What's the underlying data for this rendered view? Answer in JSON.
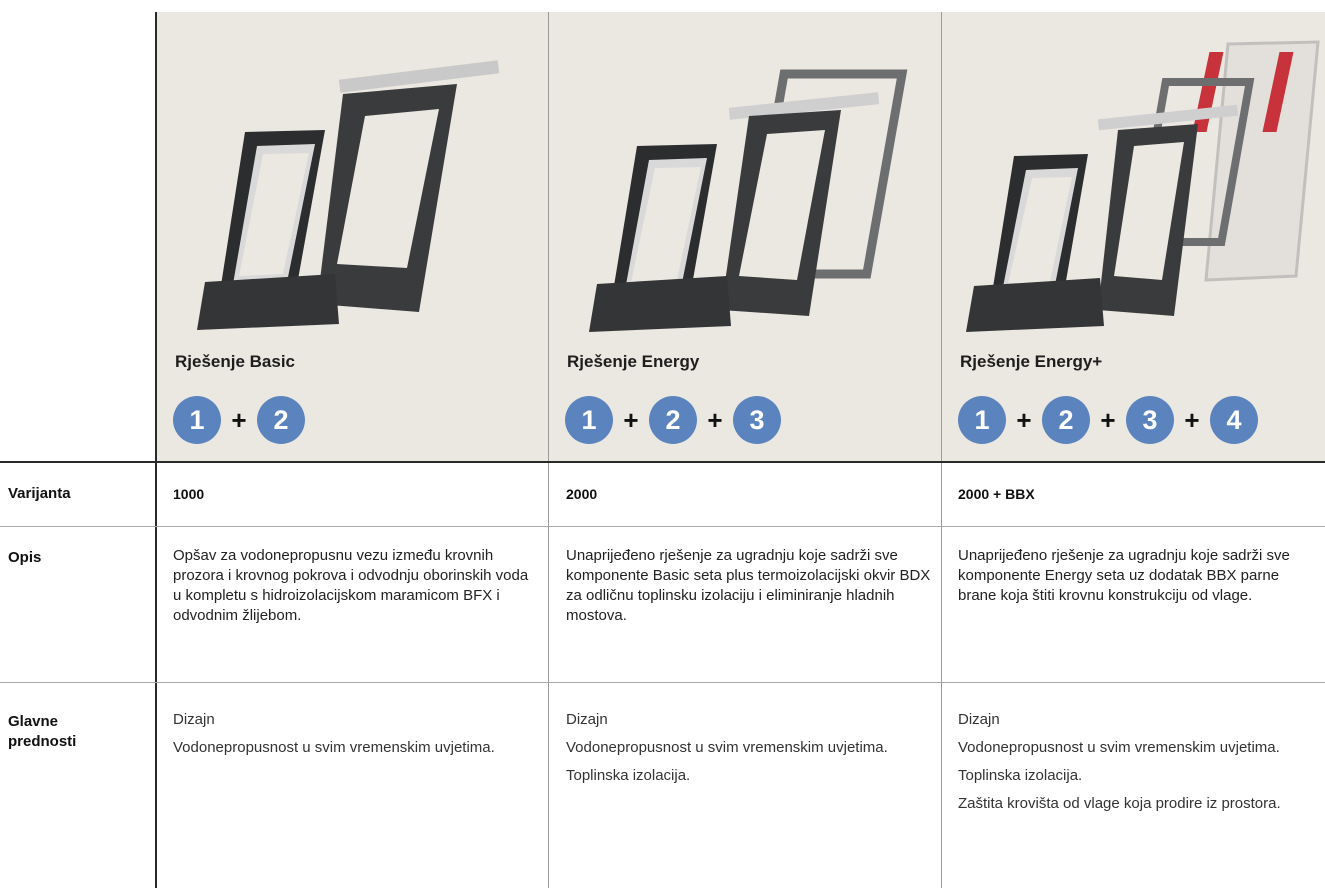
{
  "row_labels": {
    "variant": "Varijanta",
    "description": "Opis",
    "benefits": "Glavne prednosti"
  },
  "columns": [
    {
      "title": "Rješenje Basic",
      "variant": "1000",
      "description": "Opšav za vodonepropusnu vezu između krovnih prozora i krovnog pokrova i odvodnju oborinskih voda u kompletu s hidroizolacijskom maramicom BFX i odvodnim žlijebom.",
      "benefits": [
        "Dizajn",
        "Vodonepropusnost u svim vremenskim uvjetima."
      ]
    },
    {
      "title": "Rješenje Energy",
      "variant": "2000",
      "description": "Unaprijeđeno rješenje za ugradnju koje sadrži sve komponente Basic seta plus termoizolacijski okvir BDX za odličnu toplinsku izolaciju i eliminiranje hladnih mostova.",
      "benefits": [
        "Dizajn",
        "Vodonepropusnost u svim vremenskim uvjetima.",
        "Toplinska izolacija."
      ]
    },
    {
      "title": "Rješenje Energy+",
      "variant": "2000 + BBX",
      "description": "Unaprijeđeno rješenje za ugradnju koje sadrži sve komponente Energy seta uz dodatak BBX parne brane koja štiti krovnu konstrukciju od vlage.",
      "benefits": [
        "Dizajn",
        "Vodonepropusnost u svim vremenskim uvjetima.",
        "Toplinska izolacija.",
        "Zaštita krovišta od vlage koja prodire iz prostora."
      ]
    }
  ],
  "badges": {
    "one": "1",
    "two": "2",
    "three": "3",
    "four": "4",
    "plus": "+"
  },
  "colors": {
    "badge": "#5b84be",
    "header_background": "#ebe7e1",
    "flashing": "#3c3e40"
  }
}
